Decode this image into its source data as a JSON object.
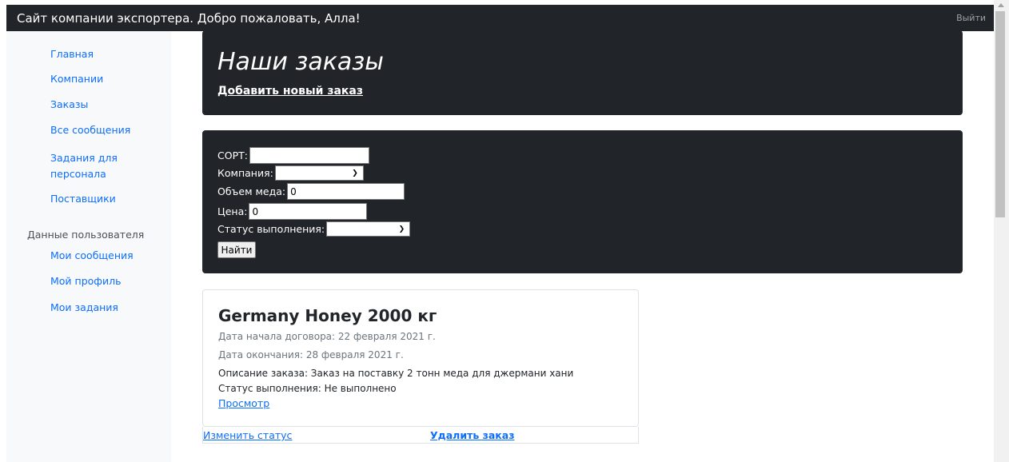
{
  "navbar": {
    "brand": "Сайт компании экспортера. Добро пожаловать, Алла!",
    "logout": "Выйти"
  },
  "sidebar": {
    "items": [
      {
        "label": "Главная"
      },
      {
        "label": "Компании"
      },
      {
        "label": "Заказы"
      },
      {
        "label": "Все сообщения"
      },
      {
        "label": "Задания для персонала"
      },
      {
        "label": "Поставщики"
      }
    ],
    "user_heading": "Данные пользователя",
    "user_items": [
      {
        "label": "Мои сообщения"
      },
      {
        "label": "Мой профиль"
      },
      {
        "label": "Мои задания"
      }
    ]
  },
  "header": {
    "title": "Наши заказы",
    "add_link": "Добавить новый заказ"
  },
  "filter": {
    "sort_label": "СОРТ:",
    "sort_value": "",
    "company_label": "Компания:",
    "company_value": "",
    "volume_label": "Объем меда:",
    "volume_value": "0",
    "price_label": "Цена:",
    "price_value": "0",
    "status_label": "Статус выполнения:",
    "status_value": "",
    "find_button": "Найти"
  },
  "order": {
    "title": "Germany Honey 2000 кг",
    "start_date": "Дата начала договора: 22 февраля 2021 г.",
    "end_date": "Дата окончания: 28 февраля 2021 г.",
    "description": "Описание заказа: Заказ на поставку 2 тонн меда для джермани хани",
    "status": "Статус выполнения: Не выполнено",
    "view_link": "Просмотр",
    "change_status_link": "Изменить статус",
    "delete_link": "Удалить заказ"
  },
  "icons": {
    "select_chevron": "chevron-down-icon",
    "scroll_up": "scroll-up-arrow-icon"
  },
  "colors": {
    "dark": "#212529",
    "link": "#0d6efd",
    "sidebar_bg": "#f8f9fa"
  }
}
